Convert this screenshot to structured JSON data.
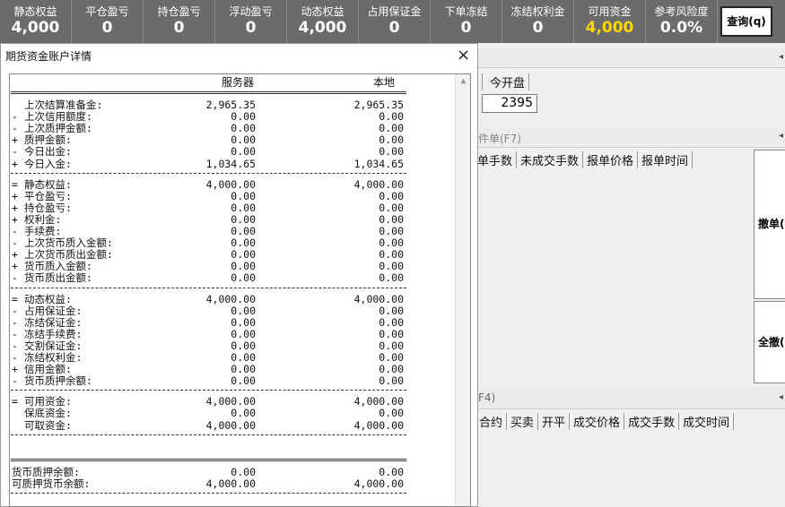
{
  "topbar": {
    "metrics": [
      {
        "label": "静态权益",
        "value": "4,000"
      },
      {
        "label": "平仓盈亏",
        "value": "0"
      },
      {
        "label": "持仓盈亏",
        "value": "0"
      },
      {
        "label": "浮动盈亏",
        "value": "0"
      },
      {
        "label": "动态权益",
        "value": "4,000"
      },
      {
        "label": "占用保证金",
        "value": "0"
      },
      {
        "label": "下单冻结",
        "value": "0"
      },
      {
        "label": "冻结权利金",
        "value": "0"
      },
      {
        "label": "可用资金",
        "value": "4,000"
      },
      {
        "label": "参考风险度",
        "value": "0.0%"
      }
    ],
    "query_label": "查询(q)"
  },
  "background": {
    "position_header": "今开盘",
    "price_value": "2395",
    "order_tab": "件单(F7)",
    "order_columns": [
      "单手数",
      "未成交手数",
      "报单价格",
      "报单时间"
    ],
    "cancel_button": "撤单(",
    "cancel_all_button": "全撤(",
    "trade_tab": "F4)",
    "trade_columns": [
      "合约",
      "买卖",
      "开平",
      "成交价格",
      "成交手数",
      "成交时间"
    ],
    "arrow": "◂"
  },
  "dialog": {
    "title": "期货资金账户详情",
    "close": "×",
    "scroll_up": "▲",
    "header_server": "服务器",
    "header_local": "本地",
    "sections": [
      [
        {
          "sign": "",
          "name": "上次结算准备金:",
          "server": "2,965.35",
          "local": "2,965.35"
        },
        {
          "sign": "-",
          "name": "上次信用额度:",
          "server": "0.00",
          "local": "0.00"
        },
        {
          "sign": "-",
          "name": "上次质押金额:",
          "server": "0.00",
          "local": "0.00"
        },
        {
          "sign": "+",
          "name": "质押金额:",
          "server": "0.00",
          "local": "0.00"
        },
        {
          "sign": "-",
          "name": "今日出金:",
          "server": "0.00",
          "local": "0.00"
        },
        {
          "sign": "+",
          "name": "今日入金:",
          "server": "1,034.65",
          "local": "1,034.65"
        }
      ],
      [
        {
          "sign": "=",
          "name": "静态权益:",
          "server": "4,000.00",
          "local": "4,000.00"
        },
        {
          "sign": "+",
          "name": "平仓盈亏:",
          "server": "0.00",
          "local": "0.00"
        },
        {
          "sign": "+",
          "name": "持仓盈亏:",
          "server": "0.00",
          "local": "0.00"
        },
        {
          "sign": "+",
          "name": "权利金:",
          "server": "0.00",
          "local": "0.00"
        },
        {
          "sign": "-",
          "name": "手续费:",
          "server": "0.00",
          "local": "0.00"
        },
        {
          "sign": "-",
          "name": "上次货币质入金额:",
          "server": "0.00",
          "local": "0.00"
        },
        {
          "sign": "+",
          "name": "上次货币质出金额:",
          "server": "0.00",
          "local": "0.00"
        },
        {
          "sign": "+",
          "name": "货币质入金额:",
          "server": "0.00",
          "local": "0.00"
        },
        {
          "sign": "-",
          "name": "货币质出金额:",
          "server": "0.00",
          "local": "0.00"
        }
      ],
      [
        {
          "sign": "=",
          "name": "动态权益:",
          "server": "4,000.00",
          "local": "4,000.00"
        },
        {
          "sign": "-",
          "name": "占用保证金:",
          "server": "0.00",
          "local": "0.00"
        },
        {
          "sign": "-",
          "name": "冻结保证金:",
          "server": "0.00",
          "local": "0.00"
        },
        {
          "sign": "-",
          "name": "冻结手续费:",
          "server": "0.00",
          "local": "0.00"
        },
        {
          "sign": "-",
          "name": "交割保证金:",
          "server": "0.00",
          "local": "0.00"
        },
        {
          "sign": "-",
          "name": "冻结权利金:",
          "server": "0.00",
          "local": "0.00"
        },
        {
          "sign": "+",
          "name": "信用金额:",
          "server": "0.00",
          "local": "0.00"
        },
        {
          "sign": "-",
          "name": "货币质押余额:",
          "server": "0.00",
          "local": "0.00"
        }
      ],
      [
        {
          "sign": "=",
          "name": "可用资金:",
          "server": "4,000.00",
          "local": "4,000.00"
        },
        {
          "sign": "",
          "name": "保底资金:",
          "server": "0.00",
          "local": "0.00"
        },
        {
          "sign": "",
          "name": "可取资金:",
          "server": "4,000.00",
          "local": "4,000.00"
        }
      ],
      [
        {
          "sign": "",
          "name": "货币质押余额:",
          "server": "0.00",
          "local": "0.00",
          "flush": true
        },
        {
          "sign": "",
          "name": "可质押货币余额:",
          "server": "4,000.00",
          "local": "4,000.00",
          "flush": true
        }
      ]
    ]
  }
}
